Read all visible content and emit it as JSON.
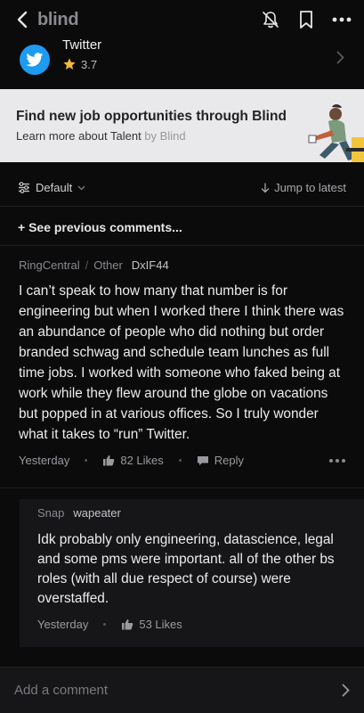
{
  "header": {
    "logo_text": "blind",
    "icons": [
      "back-chevron-icon",
      "bell-off-icon",
      "bookmark-icon",
      "more-icon"
    ]
  },
  "company": {
    "name": "Twitter",
    "rating": "3.7",
    "logo_color": "#1d9bf0"
  },
  "banner": {
    "title": "Find new job opportunities through Blind",
    "subtitle": "Learn more about Talent",
    "by": "by Blind"
  },
  "sort": {
    "label": "Default",
    "jump_label": "Jump to latest"
  },
  "previous_label": "+ See previous comments...",
  "comment": {
    "company": "RingCentral",
    "separator": "/",
    "role": "Other",
    "username": "DxIF44",
    "text": "I can’t speak to how many that number is for engineering but when I worked there I think there was an abundance of people who did nothing but order branded schwag and schedule team lunches as full time jobs. I worked with someone who faked being at work while they flew around the globe on vacations but popped in at various offices. So I truly wonder what it takes to “run” Twitter.",
    "time": "Yesterday",
    "likes": "82 Likes",
    "reply_label": "Reply"
  },
  "reply": {
    "company": "Snap",
    "username": "wapeater",
    "text": "Idk probably only engineering, datascience, legal and some pms were important. all of the other bs roles (with all due respect of course) were overstaffed.",
    "time": "Yesterday",
    "likes": "53 Likes"
  },
  "compose": {
    "placeholder": "Add a comment"
  },
  "colors": {
    "background": "#0b0b0c",
    "banner_bg": "#e9e8ea",
    "reply_bg": "#161618",
    "star": "#f5b642"
  }
}
